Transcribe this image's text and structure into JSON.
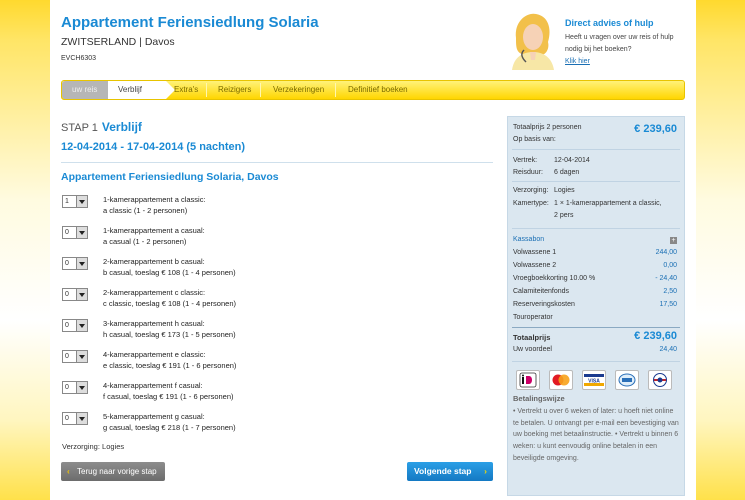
{
  "header": {
    "title": "Appartement Feriensiedlung Solaria",
    "location": "ZWITSERLAND | Davos",
    "code": "EVCH6303",
    "help_title": "Direct advies of hulp",
    "help_text": "Heeft u vragen over uw reis of hulp nodig bij het boeken?",
    "help_link": "Klik hier"
  },
  "steps": [
    "uw reis",
    "Verblijf",
    "Extra's",
    "Reizigers",
    "Verzekeringen",
    "Definitief boeken"
  ],
  "main": {
    "stap_label": "STAP 1",
    "stap_title": "Verblijf",
    "dates": "12-04-2014 - 17-04-2014 (5 nachten)",
    "hotel_title": "Appartement Feriensiedlung Solaria, Davos",
    "rooms": [
      {
        "qty": "1",
        "line1": "1-kamerappartement a classic:",
        "line2": "a classic (1 - 2 personen)"
      },
      {
        "qty": "0",
        "line1": "1-kamerappartement a casual:",
        "line2": "a casual (1 - 2 personen)"
      },
      {
        "qty": "0",
        "line1": "2-kamerappartement b casual:",
        "line2": "b casual, toeslag € 108 (1 - 4 personen)"
      },
      {
        "qty": "0",
        "line1": "2-kamerappartement c classic:",
        "line2": "c classic, toeslag € 108 (1 - 4 personen)"
      },
      {
        "qty": "0",
        "line1": "3-kamerappartement h casual:",
        "line2": "h casual, toeslag € 173 (1 - 5 personen)"
      },
      {
        "qty": "0",
        "line1": "4-kamerappartement e classic:",
        "line2": "e classic, toeslag € 191 (1 - 6 personen)"
      },
      {
        "qty": "0",
        "line1": "4-kamerappartement f casual:",
        "line2": "f casual, toeslag € 191 (1 - 6 personen)"
      },
      {
        "qty": "0",
        "line1": "5-kamerappartement g casual:",
        "line2": "g casual, toeslag € 218 (1 - 7 personen)"
      }
    ],
    "verzorging": "Verzorging: Logies",
    "back_button": "Terug naar vorige stap",
    "next_button": "Volgende stap"
  },
  "summary": {
    "total_label_1": "Totaalprijs 2 personen",
    "total_label_2": "Op basis van:",
    "total_price": "€ 239,60",
    "vertrek_label": "Vertrek:",
    "vertrek_value": "12-04-2014",
    "reisduur_label": "Reisduur:",
    "reisduur_value": "6 dagen",
    "verzorging_label": "Verzorging:",
    "verzorging_value": "Logies",
    "kamertype_label": "Kamertype:",
    "kamertype_value_1": "1 × 1-kamerappartement a classic,",
    "kamertype_value_2": "2 pers",
    "kassabon": "Kassabon",
    "lines": [
      {
        "label": "Volwassene 1",
        "amount": "244,00"
      },
      {
        "label": "Volwassene 2",
        "amount": "0,00"
      },
      {
        "label": "Vroegboekkorting 10.00 %",
        "amount": "- 24,40"
      },
      {
        "label": "Calamiteitenfonds",
        "amount": "2,50"
      },
      {
        "label": "Reserveringskosten",
        "amount": "17,50"
      },
      {
        "label": "Touroperator",
        "amount": ""
      }
    ],
    "totaal_label": "Totaalprijs",
    "totaal_value": "€ 239,60",
    "voordeel_label": "Uw voordeel",
    "voordeel_value": "24,40",
    "betaal_title": "Betalingswijze",
    "betaal_text": "• Vertrekt u over 6 weken of later: u hoeft niet online te betalen. U ontvangt per e-mail een bevestiging van uw boeking met betaalinstructie. • Vertrekt u binnen 6 weken: u kunt eenvoudig online betalen in een beveiligde omgeving."
  },
  "payment_logos": [
    "ideal-icon",
    "mastercard-icon",
    "visa-icon",
    "bank-icon",
    "secure-icon"
  ]
}
